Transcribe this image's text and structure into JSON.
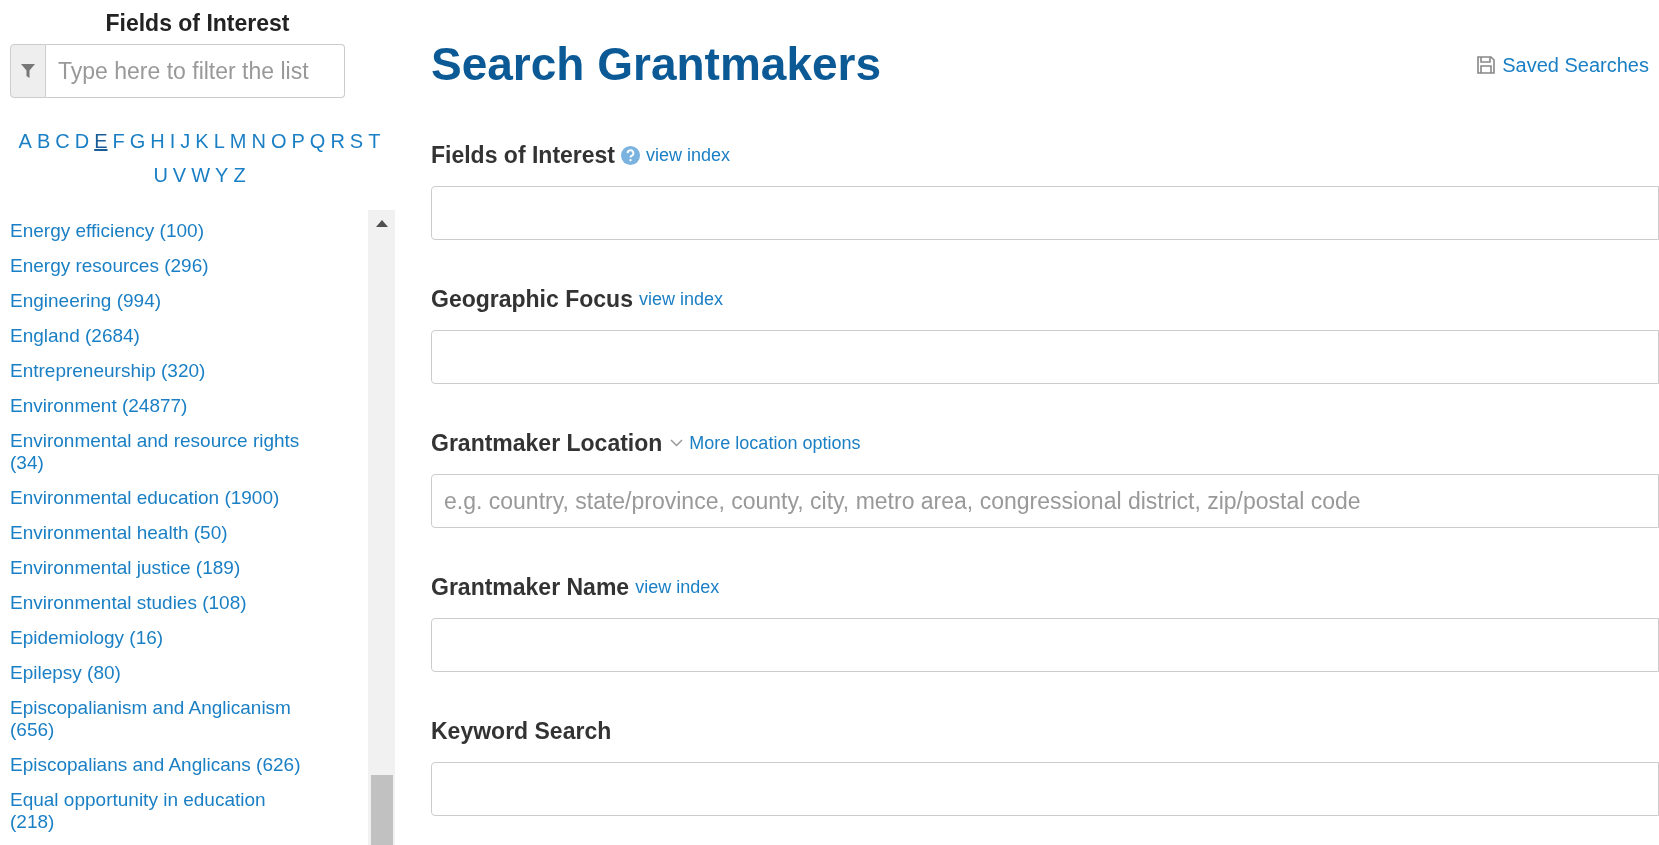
{
  "sidebar": {
    "title": "Fields of Interest",
    "filter": {
      "placeholder": "Type here to filter the list"
    },
    "letters": [
      {
        "label": "A",
        "selected": false
      },
      {
        "label": "B",
        "selected": false
      },
      {
        "label": "C",
        "selected": false
      },
      {
        "label": "D",
        "selected": false
      },
      {
        "label": "E",
        "selected": true
      },
      {
        "label": "F",
        "selected": false
      },
      {
        "label": "G",
        "selected": false
      },
      {
        "label": "H",
        "selected": false
      },
      {
        "label": "I",
        "selected": false
      },
      {
        "label": "J",
        "selected": false
      },
      {
        "label": "K",
        "selected": false
      },
      {
        "label": "L",
        "selected": false
      },
      {
        "label": "M",
        "selected": false
      },
      {
        "label": "N",
        "selected": false
      },
      {
        "label": "O",
        "selected": false
      },
      {
        "label": "P",
        "selected": false
      },
      {
        "label": "Q",
        "selected": false
      },
      {
        "label": "R",
        "selected": false
      },
      {
        "label": "S",
        "selected": false
      },
      {
        "label": "T",
        "selected": false
      },
      {
        "label": "U",
        "selected": false
      },
      {
        "label": "V",
        "selected": false
      },
      {
        "label": "W",
        "selected": false
      },
      {
        "label": "Y",
        "selected": false
      },
      {
        "label": "Z",
        "selected": false
      }
    ],
    "items": [
      "Energy efficiency (100)",
      "Energy resources (296)",
      "Engineering (994)",
      "England (2684)",
      "Entrepreneurship (320)",
      "Environment (24877)",
      "Environmental and resource rights (34)",
      "Environmental education (1900)",
      "Environmental health (50)",
      "Environmental justice (189)",
      "Environmental studies (108)",
      "Epidemiology (16)",
      "Epilepsy (80)",
      "Episcopalianism and Anglicanism (656)",
      "Episcopalians and Anglicans (626)",
      "Equal opportunity in education (218)"
    ]
  },
  "main": {
    "title": "Search Grantmakers",
    "saved_searches": "Saved Searches",
    "fields": [
      {
        "label": "Fields of Interest",
        "help": true,
        "link": "view index"
      },
      {
        "label": "Geographic Focus",
        "link": "view index"
      },
      {
        "label": "Grantmaker Location",
        "dropdown": "More location options",
        "placeholder": "e.g. country, state/province, county, city, metro area, congressional district, zip/postal code"
      },
      {
        "label": "Grantmaker Name",
        "link": "view index"
      },
      {
        "label": "Keyword Search"
      }
    ]
  }
}
